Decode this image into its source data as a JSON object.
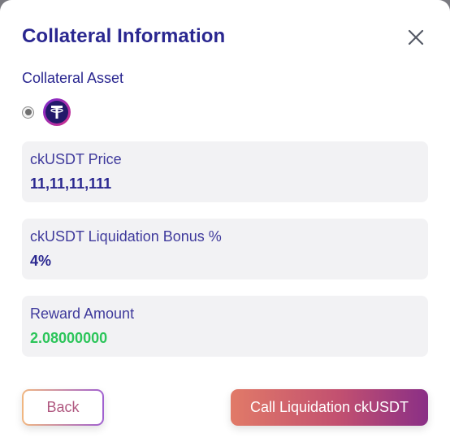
{
  "modal": {
    "title": "Collateral Information",
    "collateral_asset_label": "Collateral Asset",
    "asset": {
      "icon": "tether-logo-icon",
      "selected": true
    },
    "cards": [
      {
        "label": "ckUSDT Price",
        "value": "11,11,11,111"
      },
      {
        "label": "ckUSDT Liquidation Bonus %",
        "value": "4%"
      },
      {
        "label": "Reward Amount",
        "value": "2.08000000"
      }
    ],
    "buttons": {
      "back": "Back",
      "call": "Call Liquidation ckUSDT"
    }
  },
  "colors": {
    "title": "#2a2790",
    "reward_value": "#2cc55a",
    "card_bg": "#f2f2f4"
  }
}
